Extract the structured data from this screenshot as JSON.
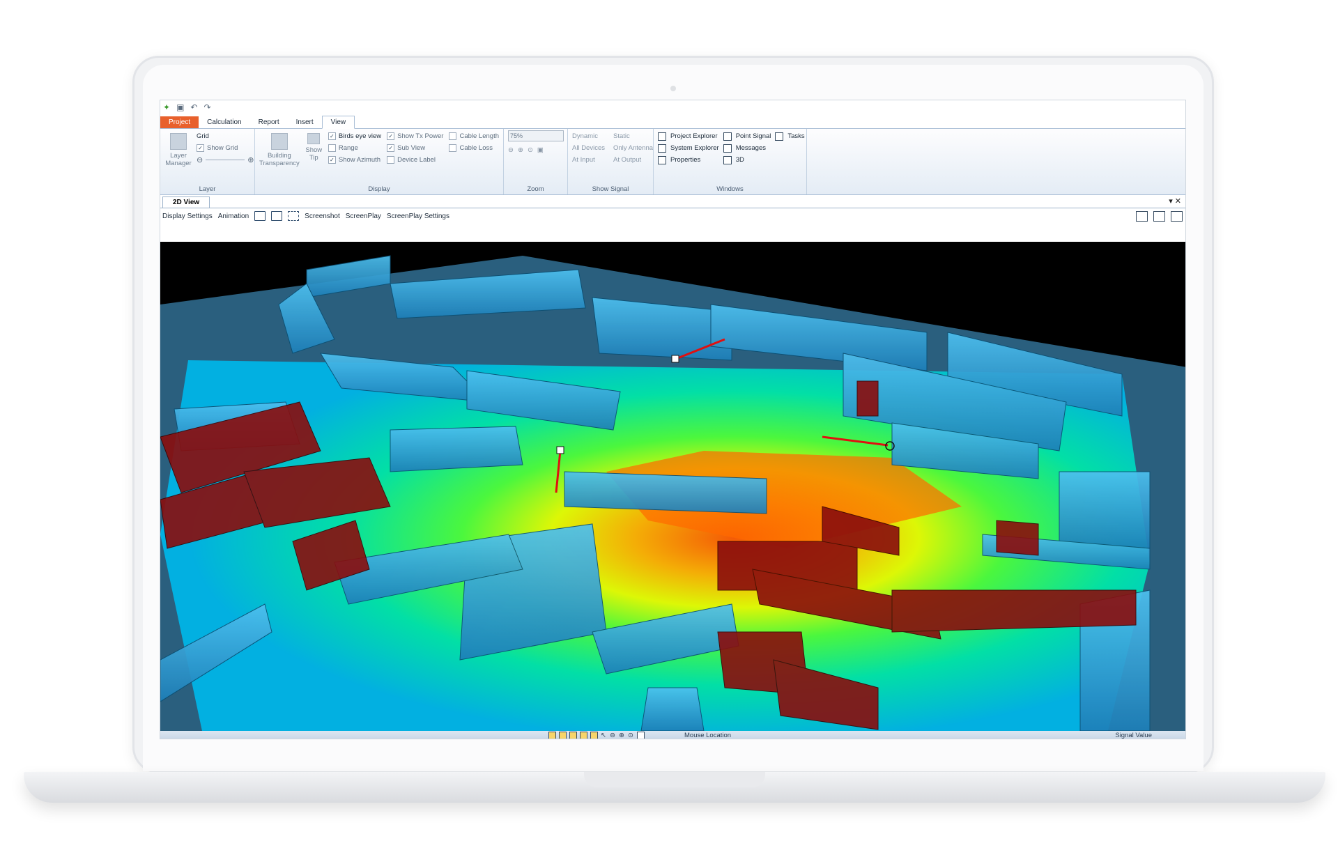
{
  "tabs": [
    "Project",
    "Calculation",
    "Report",
    "Insert",
    "View"
  ],
  "active_tab": "View",
  "ribbon": {
    "layer": {
      "layer_manager": "Layer Manager",
      "grid": "Grid",
      "show_grid": "Show Grid",
      "label": "Layer"
    },
    "display": {
      "building_transparency": "Building Transparency",
      "show_tip": "Show Tip",
      "checkboxes_col1": [
        {
          "label": "Birds eye view",
          "checked": true
        },
        {
          "label": "Range",
          "checked": false
        },
        {
          "label": "Show Azimuth",
          "checked": true
        }
      ],
      "checkboxes_col2": [
        {
          "label": "Show Tx Power",
          "checked": true
        },
        {
          "label": "Sub View",
          "checked": true
        },
        {
          "label": "Device Label",
          "checked": false
        }
      ],
      "checkboxes_col3": [
        {
          "label": "Cable Length",
          "checked": false
        },
        {
          "label": "Cable Loss",
          "checked": false
        }
      ],
      "label": "Display"
    },
    "zoom": {
      "value": "75%",
      "label": "Zoom"
    },
    "show_signal": {
      "col1": [
        "Dynamic",
        "All Devices",
        "At Input"
      ],
      "col2": [
        "Static",
        "Only Antenna",
        "At Output"
      ],
      "label": "Show Signal"
    },
    "windows": {
      "col1": [
        "Project Explorer",
        "System Explorer",
        "Properties"
      ],
      "col2": [
        "Point Signal",
        "Messages",
        "3D"
      ],
      "col3": [
        "Tasks"
      ],
      "label": "Windows"
    }
  },
  "view_tab": "2D View",
  "toolbar": {
    "display_settings": "Display Settings",
    "animation": "Animation",
    "screenshot": "Screenshot",
    "screenplay": "ScreenPlay",
    "screenplay_settings": "ScreenPlay Settings"
  },
  "status": {
    "mouse_location": "Mouse Location",
    "signal_value": "Signal Value"
  },
  "colors": {
    "project_tab": "#e8602c",
    "ribbon_border": "#a9bed6",
    "heat_high": "#ff6a00",
    "heat_mid": "#e6ff00",
    "heat_low": "#00c8ff",
    "wall_blue": "#33a9e6",
    "wall_red": "#8a0d0d",
    "floor": "#2a5f7e",
    "sky": "#000000"
  }
}
